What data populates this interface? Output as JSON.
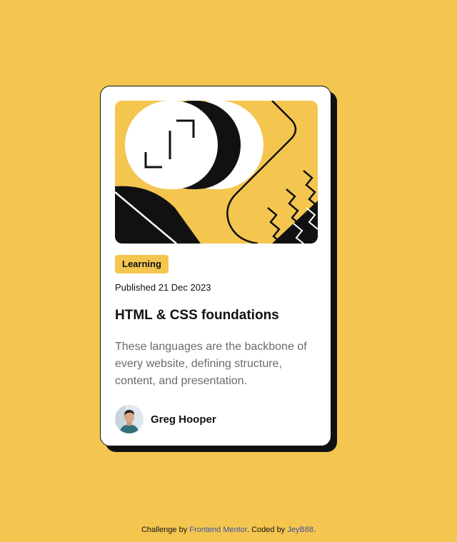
{
  "colors": {
    "background": "#f4c650",
    "card": "#ffffff",
    "ink": "#111111",
    "muted_text": "#6b6b6b",
    "link": "#3e52a3"
  },
  "card": {
    "illustration": "abstract-geometric-illustration",
    "tag": "Learning",
    "published": "Published 21 Dec 2023",
    "title": "HTML & CSS foundations",
    "description": "These languages are the backbone of every website, defining structure, content, and presentation.",
    "author": {
      "avatar": "author-avatar-image",
      "name": "Greg Hooper"
    }
  },
  "attribution": {
    "prefix": "Challenge by ",
    "link1": "Frontend Mentor",
    "middle": ". Coded by ",
    "link2": "JeyB88",
    "suffix": "."
  }
}
